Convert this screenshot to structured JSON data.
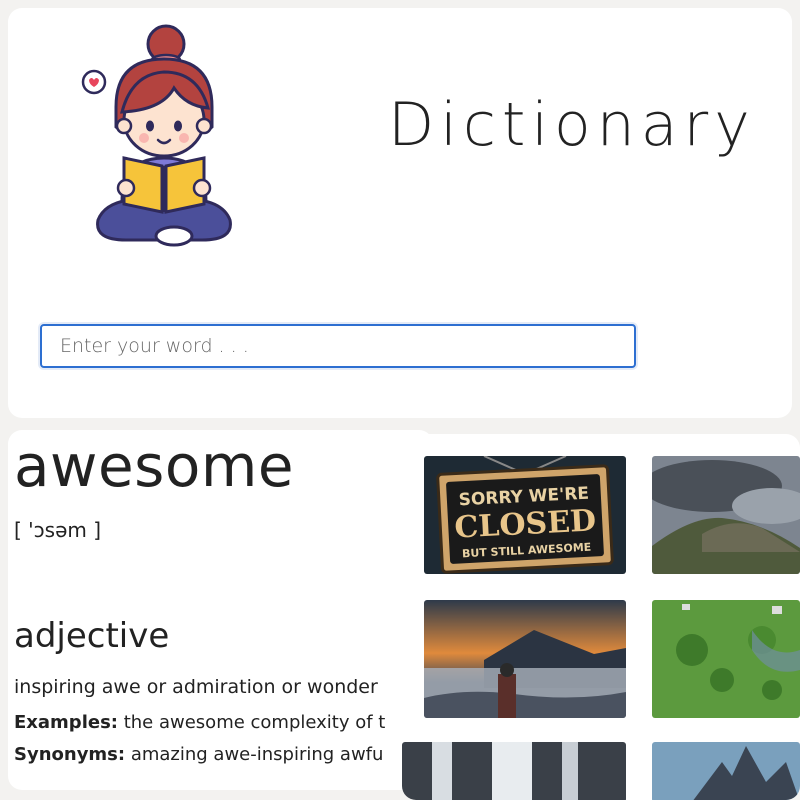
{
  "header": {
    "title": "Dictionary",
    "search_placeholder": "Enter your word . . ."
  },
  "result": {
    "word": "awesome",
    "phonetic": "[ 'ɔsəm ]",
    "part_of_speech": "adjective",
    "definition": "inspiring awe or admiration or wonder",
    "examples_label": "Examples:",
    "examples_value": "the awesome complexity of t",
    "synonyms_label": "Synonyms:",
    "synonyms_value": "amazing awe-inspiring awfu"
  },
  "images": {
    "sign_line1": "SORRY WE'RE",
    "sign_line2": "CLOSED",
    "sign_line3": "BUT STILL AWESOME"
  },
  "colors": {
    "accent": "#2d6fd1",
    "background": "#f3f2f0",
    "card": "#ffffff"
  }
}
